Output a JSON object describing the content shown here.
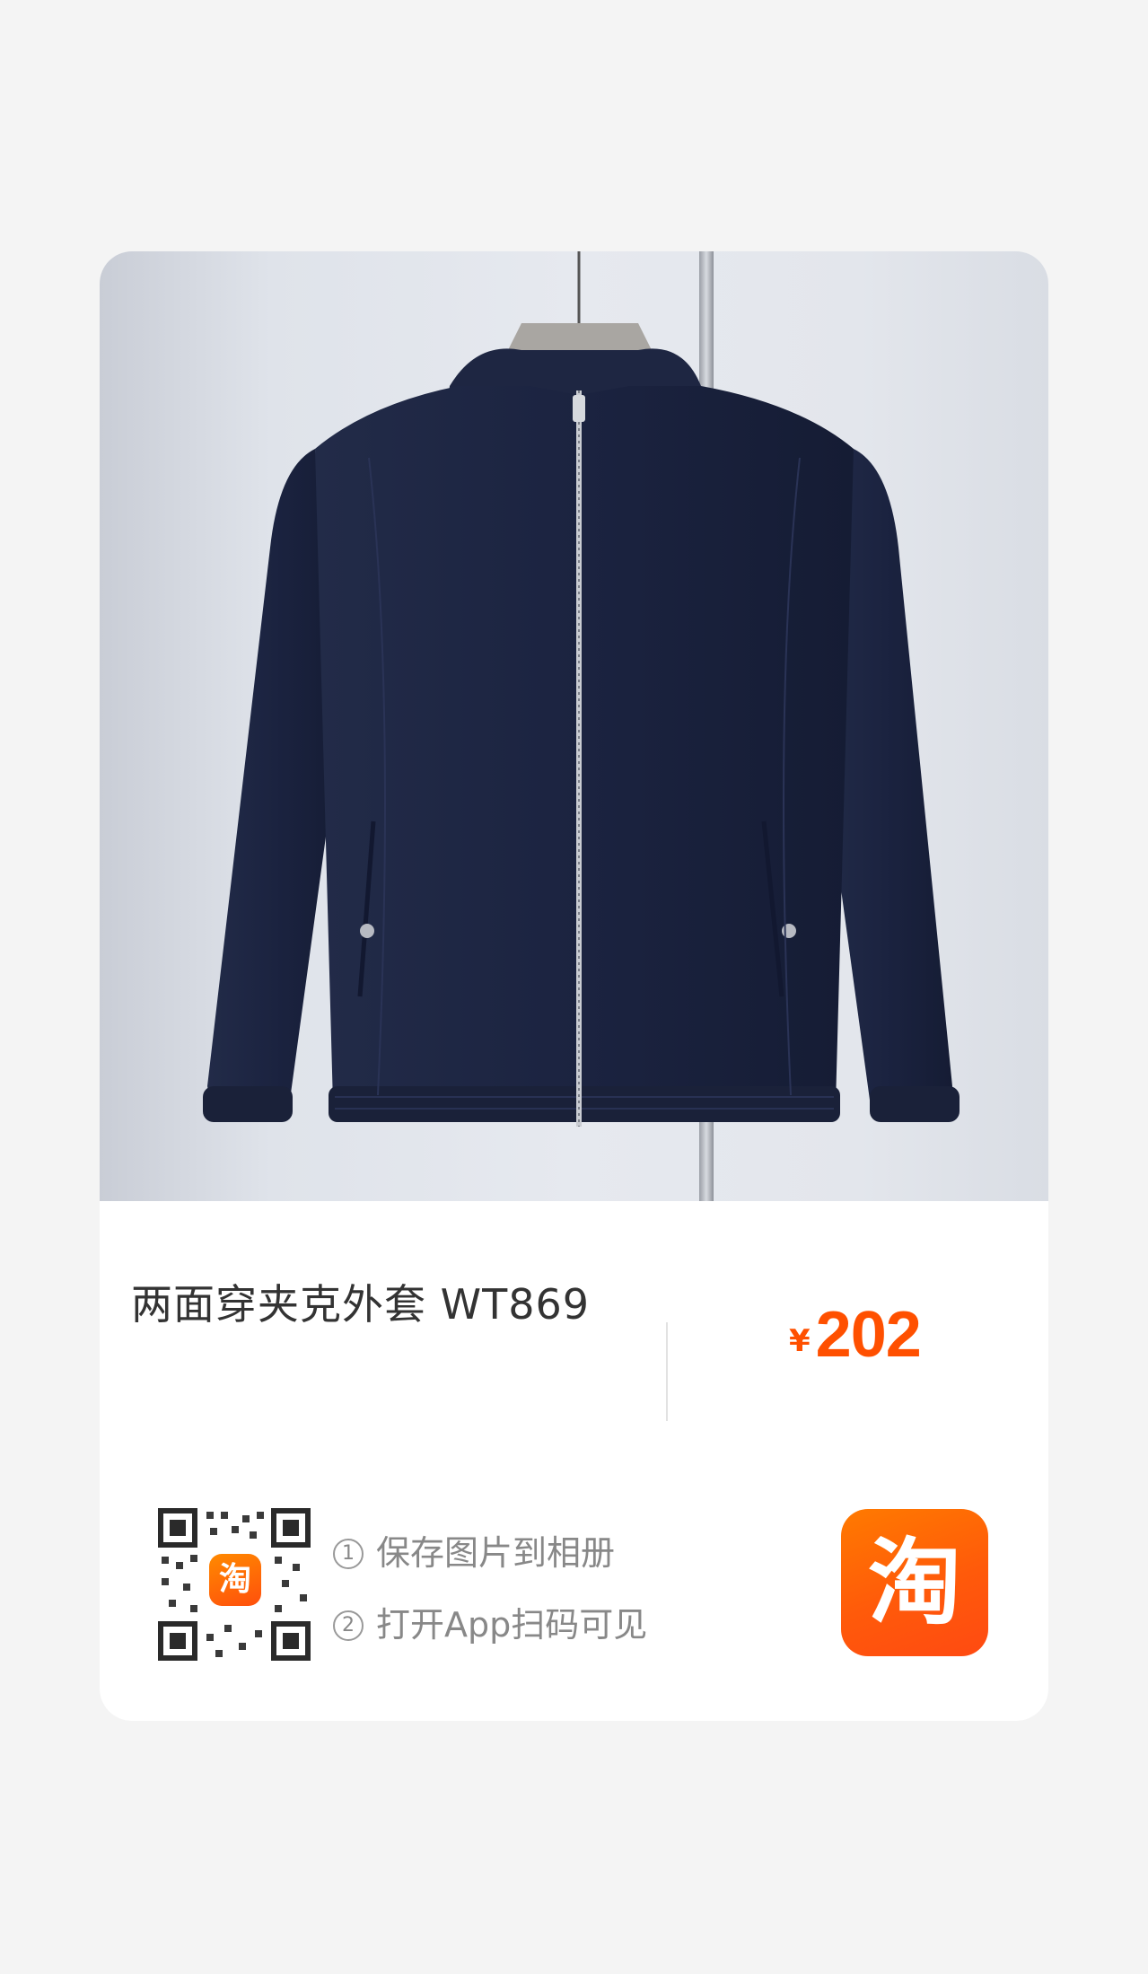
{
  "product": {
    "title": "两面穿夹克外套 WT869",
    "price_currency": "¥",
    "price_amount": "202"
  },
  "qr": {
    "logo_char": "淘"
  },
  "instructions": [
    {
      "num": "1",
      "text": "保存图片到相册"
    },
    {
      "num": "2",
      "text": "打开App扫码可见"
    }
  ],
  "app_logo": {
    "char": "淘"
  },
  "colors": {
    "price": "#ff5000",
    "brand_orange": "#ff5a0a",
    "jacket_navy": "#1c2440"
  },
  "icons": {
    "qr_code": "qr-code-icon",
    "taobao": "taobao-logo-icon"
  }
}
